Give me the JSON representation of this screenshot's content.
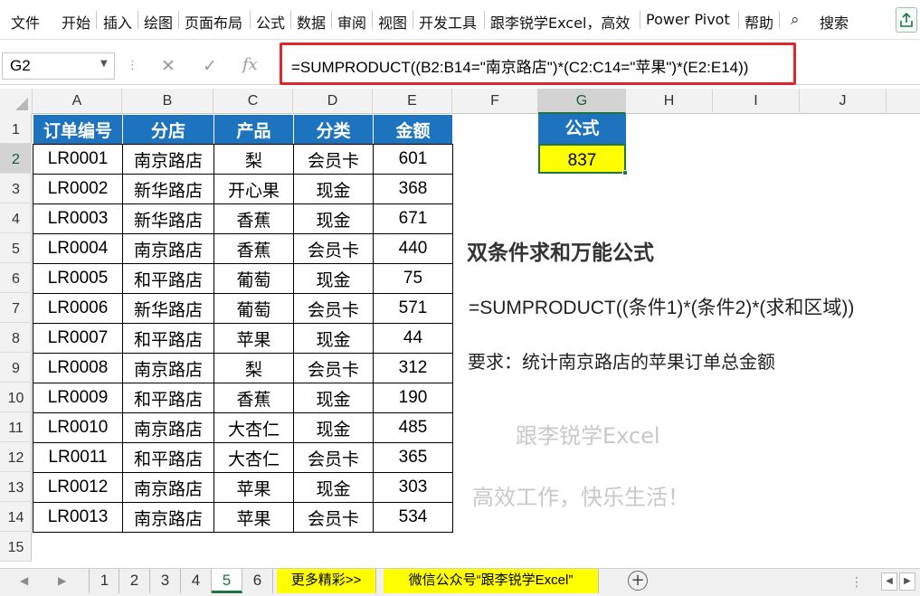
{
  "menu": [
    "文件",
    "开始",
    "插入",
    "绘图",
    "页面布局",
    "公式",
    "数据",
    "审阅",
    "视图",
    "开发工具",
    "跟李锐学Excel，高效",
    "Power Pivot",
    "帮助"
  ],
  "search_label": "搜索",
  "name_box": "G2",
  "formula": "=SUMPRODUCT((B2:B14=\"南京路店\")*(C2:C14=\"苹果\")*(E2:E14))",
  "columns": [
    "A",
    "B",
    "C",
    "D",
    "E",
    "F",
    "G",
    "H",
    "I",
    "J"
  ],
  "rows": [
    "1",
    "2",
    "3",
    "4",
    "5",
    "6",
    "7",
    "8",
    "9",
    "10",
    "11",
    "12",
    "13",
    "14",
    "15"
  ],
  "table": {
    "headers": [
      "订单编号",
      "分店",
      "产品",
      "分类",
      "金额"
    ],
    "rows": [
      [
        "LR0001",
        "南京路店",
        "梨",
        "会员卡",
        "601"
      ],
      [
        "LR0002",
        "新华路店",
        "开心果",
        "现金",
        "368"
      ],
      [
        "LR0003",
        "新华路店",
        "香蕉",
        "现金",
        "671"
      ],
      [
        "LR0004",
        "南京路店",
        "香蕉",
        "会员卡",
        "440"
      ],
      [
        "LR0005",
        "和平路店",
        "葡萄",
        "现金",
        "75"
      ],
      [
        "LR0006",
        "新华路店",
        "葡萄",
        "会员卡",
        "571"
      ],
      [
        "LR0007",
        "和平路店",
        "苹果",
        "现金",
        "44"
      ],
      [
        "LR0008",
        "南京路店",
        "梨",
        "会员卡",
        "312"
      ],
      [
        "LR0009",
        "和平路店",
        "香蕉",
        "现金",
        "190"
      ],
      [
        "LR0010",
        "南京路店",
        "大杏仁",
        "现金",
        "485"
      ],
      [
        "LR0011",
        "和平路店",
        "大杏仁",
        "会员卡",
        "365"
      ],
      [
        "LR0012",
        "南京路店",
        "苹果",
        "现金",
        "303"
      ],
      [
        "LR0013",
        "南京路店",
        "苹果",
        "会员卡",
        "534"
      ]
    ]
  },
  "formula_cell": {
    "header": "公式",
    "value": "837"
  },
  "notes": {
    "title": "双条件求和万能公式",
    "formula": "=SUMPRODUCT((条件1)*(条件2)*(求和区域))",
    "requirement": "要求：统计南京路店的苹果订单总金额",
    "watermark1": "跟李锐学Excel",
    "watermark2": "高效工作，快乐生活！"
  },
  "tabs": [
    "1",
    "2",
    "3",
    "4",
    "5",
    "6",
    "更多精彩>>",
    "微信公众号“跟李锐学Excel”"
  ],
  "active_tab": "5",
  "colors": {
    "header_blue": "#1e73be",
    "highlight_yellow": "#ffff00",
    "excel_green": "#217346",
    "callout_red": "#e0262b"
  }
}
